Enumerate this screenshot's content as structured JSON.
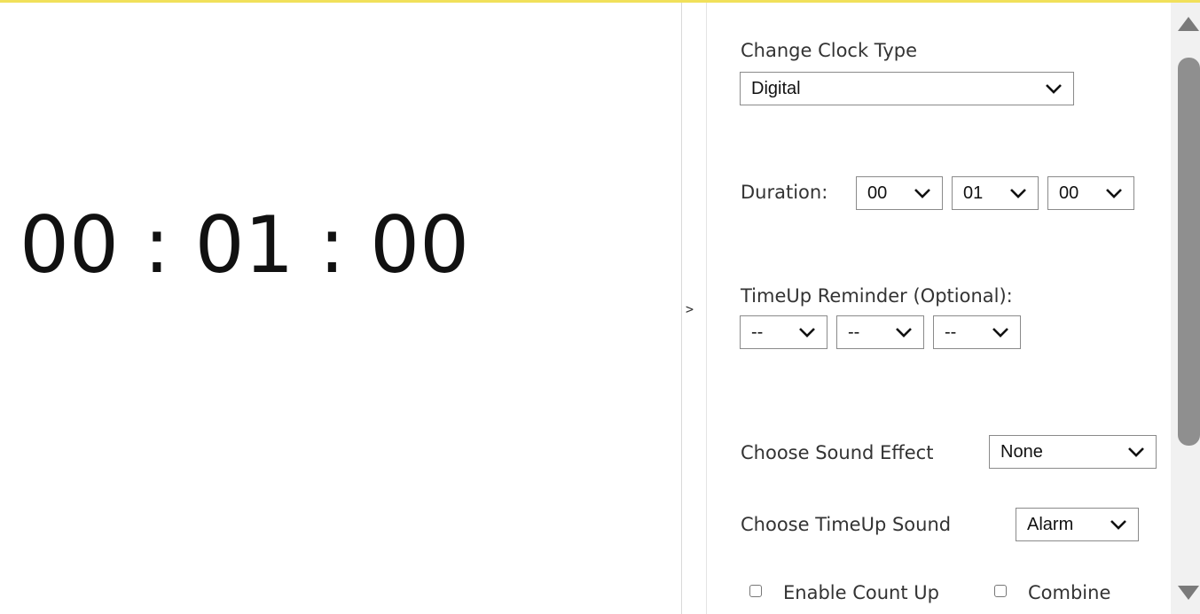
{
  "clock": {
    "display": "00 : 01 : 00"
  },
  "panel_toggle": {
    "label": ">"
  },
  "settings": {
    "clock_type": {
      "label": "Change Clock Type",
      "value": "Digital"
    },
    "duration": {
      "label": "Duration:",
      "hours": "00",
      "minutes": "01",
      "seconds": "00"
    },
    "reminder": {
      "label": "TimeUp Reminder (Optional):",
      "hours": "--",
      "minutes": "--",
      "seconds": "--"
    },
    "sound_effect": {
      "label": "Choose Sound Effect",
      "value": "None"
    },
    "timeup_sound": {
      "label": "Choose TimeUp Sound",
      "value": "Alarm"
    },
    "count_up": {
      "label": "Enable Count Up"
    },
    "combine": {
      "label": "Combine"
    }
  },
  "icons": {
    "chevron": "chevron-down-icon",
    "scroll_up": "triangle-up-icon",
    "scroll_down": "triangle-down-icon"
  },
  "colors": {
    "top_accent": "#f1e05a",
    "scroll_thumb": "#8f8f8f"
  }
}
